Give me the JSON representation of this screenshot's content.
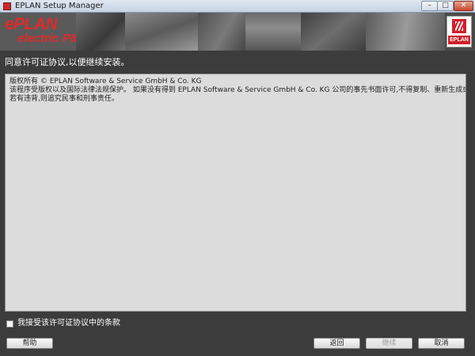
{
  "window": {
    "title": "EPLAN Setup Manager",
    "controls": {
      "minimize": "–",
      "maximize": "□",
      "close": "✕"
    }
  },
  "banner": {
    "logo_eplan": "ePLAN",
    "logo_electric": "electric P8",
    "brand_label": "EPLAN"
  },
  "instruction": "同意许可证协议,以便继续安装。",
  "license": {
    "lines": [
      "版权所有 © EPLAN Software & Service GmbH & Co. KG",
      "该程序受版权以及国际法律法规保护。  如果没有得到 EPLAN Software &  Service GmbH & Co. KG 公司的事先书面许可,不得复制、重新生成或以任何方式复印该程序或部分程序。",
      "若有违背,则追究民事和刑事责任。"
    ]
  },
  "accept": {
    "label": "我接受该许可证协议中的条款",
    "checked": false
  },
  "buttons": {
    "help": "帮助",
    "back": "返回",
    "next": "继续",
    "cancel": "取消"
  },
  "colors": {
    "brand_red": "#d1202a",
    "background": "#3c3c3c",
    "license_bg": "#dcdcdc"
  }
}
